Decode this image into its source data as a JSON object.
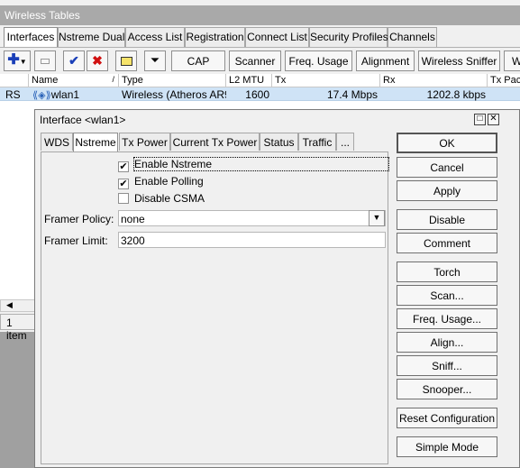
{
  "window": {
    "title": "Wireless Tables"
  },
  "tabs": [
    {
      "label": "Interfaces"
    },
    {
      "label": "Nstreme Dual"
    },
    {
      "label": "Access List"
    },
    {
      "label": "Registration"
    },
    {
      "label": "Connect List"
    },
    {
      "label": "Security Profiles"
    },
    {
      "label": "Channels"
    }
  ],
  "toolbar": {
    "add_icon": "plus-icon",
    "remove_icon": "minus-icon",
    "enable_icon": "check-icon",
    "disable_icon": "cross-icon",
    "comment_icon": "note-icon",
    "filter_icon": "filter-icon",
    "buttons": [
      {
        "label": "CAP"
      },
      {
        "label": "Scanner"
      },
      {
        "label": "Freq. Usage"
      },
      {
        "label": "Alignment"
      },
      {
        "label": "Wireless Sniffer"
      },
      {
        "label": "W"
      }
    ]
  },
  "table": {
    "columns": [
      "Name",
      "Type",
      "L2 MTU",
      "Tx",
      "Rx",
      "Tx Pac"
    ],
    "rows": [
      {
        "flags": "RS",
        "name": "wlan1",
        "type": "Wireless (Atheros AR9...",
        "l2mtu": "1600",
        "tx": "17.4 Mbps",
        "rx": "1202.8 kbps"
      }
    ],
    "status": "1 item"
  },
  "dialog": {
    "title": "Interface <wlan1>",
    "tabs": [
      {
        "label": "WDS"
      },
      {
        "label": "Nstreme"
      },
      {
        "label": "Tx Power"
      },
      {
        "label": "Current Tx Power"
      },
      {
        "label": "Status"
      },
      {
        "label": "Traffic"
      },
      {
        "label": "..."
      }
    ],
    "checkboxes": [
      {
        "label": "Enable Nstreme",
        "checked": "✔"
      },
      {
        "label": "Enable Polling",
        "checked": "✔"
      },
      {
        "label": "Disable CSMA",
        "checked": ""
      }
    ],
    "framer_policy": {
      "label": "Framer Policy:",
      "value": "none"
    },
    "framer_limit": {
      "label": "Framer Limit:",
      "value": "3200"
    },
    "buttons": [
      {
        "label": "OK"
      },
      {
        "label": "Cancel"
      },
      {
        "label": "Apply"
      },
      {
        "label": "Disable"
      },
      {
        "label": "Comment"
      },
      {
        "label": "Torch"
      },
      {
        "label": "Scan..."
      },
      {
        "label": "Freq. Usage..."
      },
      {
        "label": "Align..."
      },
      {
        "label": "Sniff..."
      },
      {
        "label": "Snooper..."
      },
      {
        "label": "Reset Configuration"
      },
      {
        "label": "Simple Mode"
      }
    ]
  }
}
